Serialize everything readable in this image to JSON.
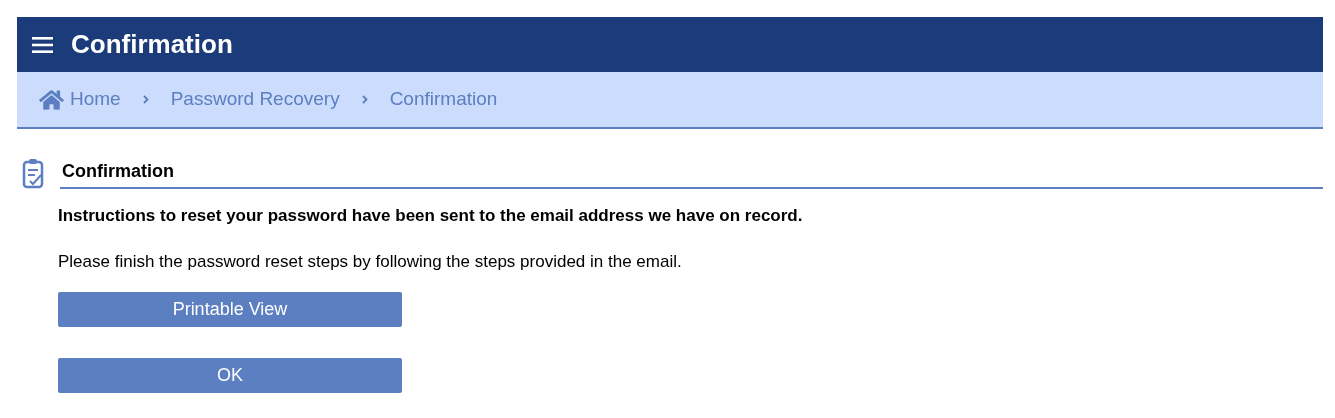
{
  "header": {
    "title": "Confirmation"
  },
  "breadcrumb": [
    {
      "label": "Home",
      "kind": "home"
    },
    {
      "label": "Password Recovery",
      "kind": "link"
    },
    {
      "label": "Confirmation",
      "kind": "link"
    }
  ],
  "section": {
    "title": "Confirmation",
    "message": "Instructions to reset your password have been sent to the email address we have on record.",
    "note": "Please finish the password reset steps by following the steps provided in the email."
  },
  "buttons": [
    "Printable View",
    "OK"
  ]
}
